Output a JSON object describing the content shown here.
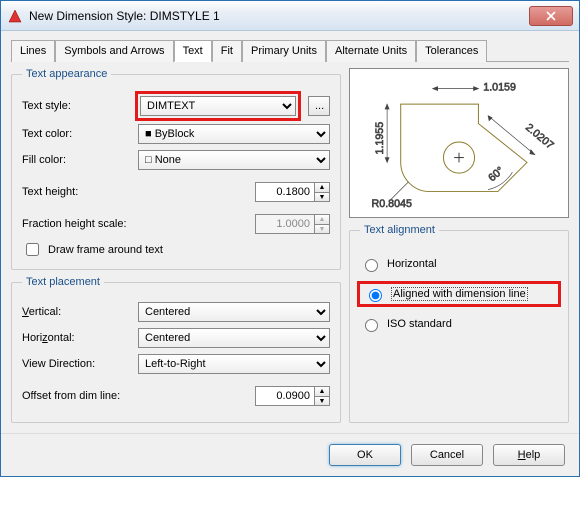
{
  "window": {
    "title": "New Dimension Style: DIMSTYLE 1"
  },
  "tabs": [
    "Lines",
    "Symbols and Arrows",
    "Text",
    "Fit",
    "Primary Units",
    "Alternate Units",
    "Tolerances"
  ],
  "active_tab": "Text",
  "appearance": {
    "legend": "Text appearance",
    "text_style_label": "Text style:",
    "text_style_value": "DIMTEXT",
    "text_color_label": "Text color:",
    "text_color_value": "ByBlock",
    "fill_color_label": "Fill color:",
    "fill_color_value": "None",
    "text_height_label": "Text height:",
    "text_height_value": "0.1800",
    "fraction_scale_label": "Fraction height scale:",
    "fraction_scale_value": "1.0000",
    "draw_frame_label": "Draw frame around text"
  },
  "placement": {
    "legend": "Text placement",
    "vertical_label": "Vertical:",
    "vertical_value": "Centered",
    "horizontal_label": "Horizontal:",
    "horizontal_value": "Centered",
    "view_dir_label": "View Direction:",
    "view_dir_value": "Left-to-Right",
    "offset_label": "Offset from dim line:",
    "offset_value": "0.0900"
  },
  "alignment": {
    "legend": "Text alignment",
    "horizontal": "Horizontal",
    "aligned": "Aligned with dimension line",
    "iso": "ISO standard",
    "selected": "aligned"
  },
  "preview_dims": {
    "top": "1.0159",
    "left": "1.1955",
    "right": "2.0207",
    "angle": "60°",
    "radius": "R0.8045"
  },
  "footer": {
    "ok": "OK",
    "cancel": "Cancel",
    "help": "Help"
  }
}
